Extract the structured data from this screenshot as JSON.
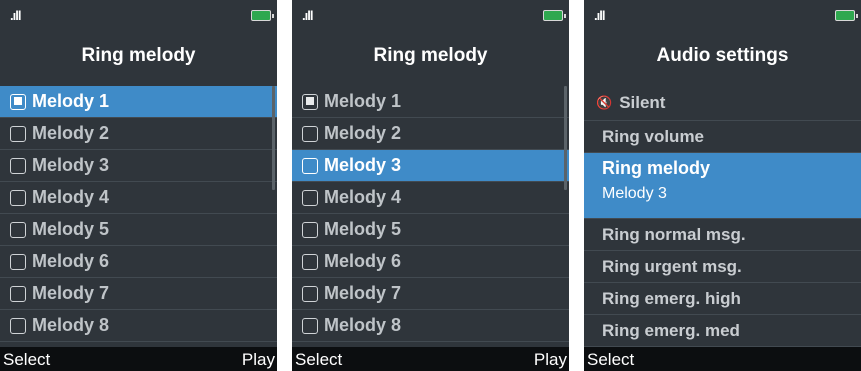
{
  "status": {
    "signal": ".ıll",
    "battery_color": "#2fa84f"
  },
  "accent_color": "#3f8bc8",
  "screens": [
    {
      "title": "Ring melody",
      "items": [
        "Melody 1",
        "Melody 2",
        "Melody 3",
        "Melody 4",
        "Melody 5",
        "Melody 6",
        "Melody 7",
        "Melody 8"
      ],
      "checked_index": 0,
      "selected_index": 0,
      "softkeys": {
        "left": "Select",
        "right": "Play"
      }
    },
    {
      "title": "Ring melody",
      "items": [
        "Melody 1",
        "Melody 2",
        "Melody 3",
        "Melody 4",
        "Melody 5",
        "Melody 6",
        "Melody 7",
        "Melody 8"
      ],
      "checked_index": 0,
      "selected_index": 2,
      "softkeys": {
        "left": "Select",
        "right": "Play"
      }
    },
    {
      "title": "Audio settings",
      "items": [
        {
          "label": "Silent",
          "icon": "speaker-muted-icon"
        },
        {
          "label": "Ring volume"
        },
        {
          "label": "Ring melody",
          "value": "Melody 3",
          "selected": true
        },
        {
          "label": "Ring normal msg."
        },
        {
          "label": "Ring urgent msg."
        },
        {
          "label": "Ring emerg. high"
        },
        {
          "label": "Ring emerg. med"
        }
      ],
      "softkeys": {
        "left": "Select"
      }
    }
  ]
}
